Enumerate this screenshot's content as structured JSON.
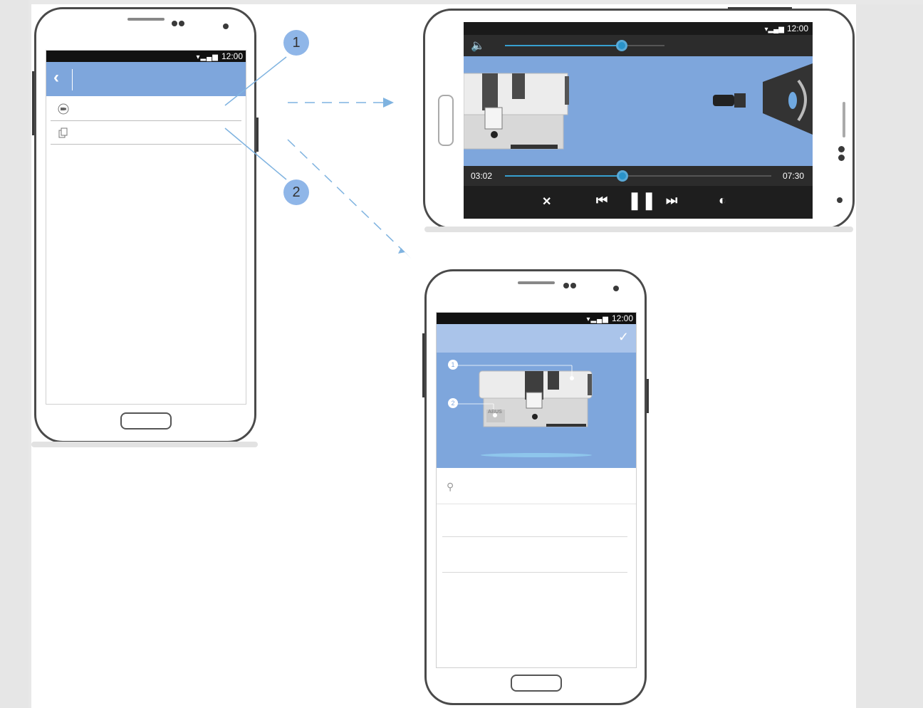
{
  "status_time": "12:00",
  "callouts": [
    "1",
    "2"
  ],
  "phone_list": {
    "back_icon": "chevron-left-icon",
    "rows": [
      {
        "icon": "video-icon"
      },
      {
        "icon": "copy-icon"
      }
    ]
  },
  "video_player": {
    "elapsed": "03:02",
    "duration": "07:30",
    "progress_fraction": 0.44,
    "volume_fraction": 0.73,
    "controls": [
      "fullscreen-exit-icon",
      "skip-back-icon",
      "pause-icon",
      "skip-forward-icon",
      "brightness-icon"
    ]
  },
  "detail_screen": {
    "check_icon": "check-icon",
    "hero_markers": [
      "1",
      "2"
    ],
    "logo_text": "ABUS"
  },
  "colors": {
    "accent_blue": "#7ea6dc",
    "light_blue": "#aac4ea",
    "arrow_blue": "#7fb3e0"
  }
}
